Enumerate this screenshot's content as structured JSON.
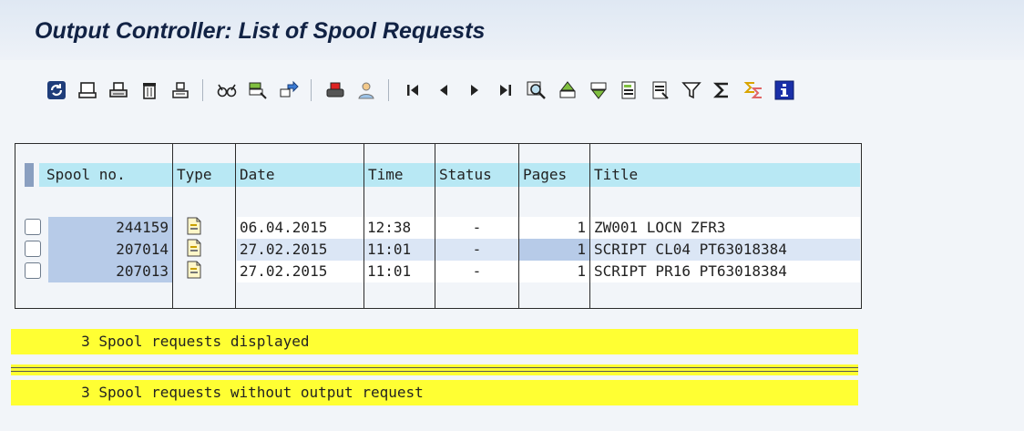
{
  "window": {
    "title": "Output Controller: List of Spool Requests"
  },
  "toolbar": {
    "buttons": [
      {
        "icon": "refresh-icon"
      },
      {
        "icon": "display-contents-icon"
      },
      {
        "icon": "print-directly-icon"
      },
      {
        "icon": "delete-icon"
      },
      {
        "icon": "print-with-changed-attributes-icon"
      },
      {
        "separator": true
      },
      {
        "icon": "display-details-icon"
      },
      {
        "icon": "output-requests-icon"
      },
      {
        "icon": "forward-icon"
      },
      {
        "separator": true
      },
      {
        "icon": "print-icon"
      },
      {
        "icon": "user-icon"
      },
      {
        "separator": true
      },
      {
        "icon": "first-page-icon"
      },
      {
        "icon": "previous-page-icon"
      },
      {
        "icon": "next-page-icon"
      },
      {
        "icon": "last-page-icon"
      },
      {
        "icon": "find-icon"
      },
      {
        "icon": "sort-ascending-icon"
      },
      {
        "icon": "sort-descending-icon"
      },
      {
        "icon": "export-icon"
      },
      {
        "icon": "local-file-icon"
      },
      {
        "icon": "filter-icon"
      },
      {
        "icon": "total-icon"
      },
      {
        "icon": "subtotal-icon"
      },
      {
        "icon": "information-icon"
      }
    ]
  },
  "list": {
    "headers": {
      "spool_no": "Spool no.",
      "type": "Type",
      "date": "Date",
      "time": "Time",
      "status": "Status",
      "pages": "Pages",
      "title": "Title"
    },
    "rows": [
      {
        "spool_no": "244159",
        "type_icon": "document-icon",
        "date": "06.04.2015",
        "time": "12:38",
        "status": "-",
        "pages": "1",
        "title": "ZW001 LOCN ZFR3"
      },
      {
        "spool_no": "207014",
        "type_icon": "document-icon",
        "date": "27.02.2015",
        "time": "11:01",
        "status": "-",
        "pages": "1",
        "title": "SCRIPT CL04 PT63018384"
      },
      {
        "spool_no": "207013",
        "type_icon": "document-icon",
        "date": "27.02.2015",
        "time": "11:01",
        "status": "-",
        "pages": "1",
        "title": "SCRIPT PR16 PT63018384"
      }
    ]
  },
  "messages": {
    "displayed": "        3 Spool requests displayed",
    "without_output": "        3 Spool requests without output request"
  },
  "colors": {
    "header_bg": "#b8e8f4",
    "key_cell": "#b7cbe8",
    "message_bg": "#ffff33"
  }
}
